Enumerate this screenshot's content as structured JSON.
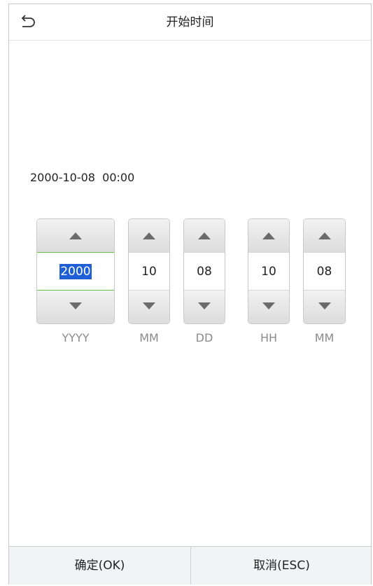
{
  "header": {
    "title": "开始时间",
    "back_icon": "undo-arrow-icon"
  },
  "summary": {
    "datetime": "2000-10-08  00:00"
  },
  "spinners": [
    {
      "value": "2000",
      "unit": "YYYY",
      "active": true
    },
    {
      "value": "10",
      "unit": "MM",
      "active": false
    },
    {
      "value": "08",
      "unit": "DD",
      "active": false
    },
    {
      "value": "10",
      "unit": "HH",
      "active": false
    },
    {
      "value": "08",
      "unit": "MM",
      "active": false
    }
  ],
  "footer": {
    "ok_label": "确定(OK)",
    "cancel_label": "取消(ESC)"
  },
  "colors": {
    "selection": "#1e5fd6",
    "focus_border": "#6abf4b",
    "footer_bg": "#f1f3f6"
  }
}
